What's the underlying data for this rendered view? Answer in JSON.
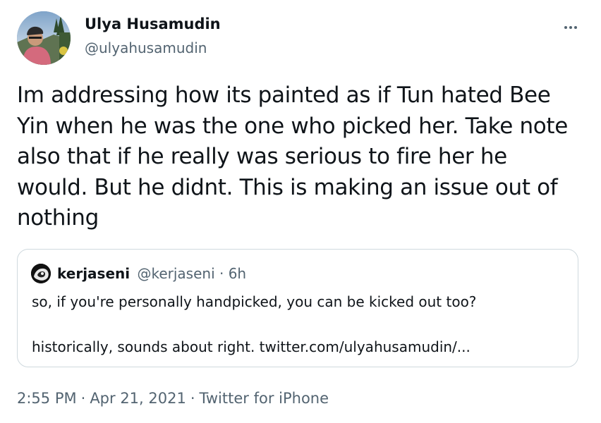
{
  "author": {
    "display_name": "Ulya Husamudin",
    "handle": "@ulyahusamudin"
  },
  "more_icon": "more-horizontal-icon",
  "tweet": {
    "text": "Im addressing how its painted as if Tun hated Bee Yin when he was the one who picked her. Take note also that if he really was serious to fire her he would. But he didnt. This is making an issue out of nothing"
  },
  "quoted_tweet": {
    "display_name": "kerjaseni",
    "meta": "@kerjaseni · 6h",
    "line1": "so, if you're personally handpicked, you can be kicked out too?",
    "line2": "historically, sounds about right. twitter.com/ulyahusamudin/..."
  },
  "footer": {
    "time": "2:55 PM",
    "date": "Apr 21, 2021",
    "source": "Twitter for iPhone",
    "separator": "·"
  },
  "colors": {
    "text_primary": "#0f1419",
    "text_secondary": "#536471",
    "border": "#cfd9de",
    "background": "#ffffff"
  }
}
